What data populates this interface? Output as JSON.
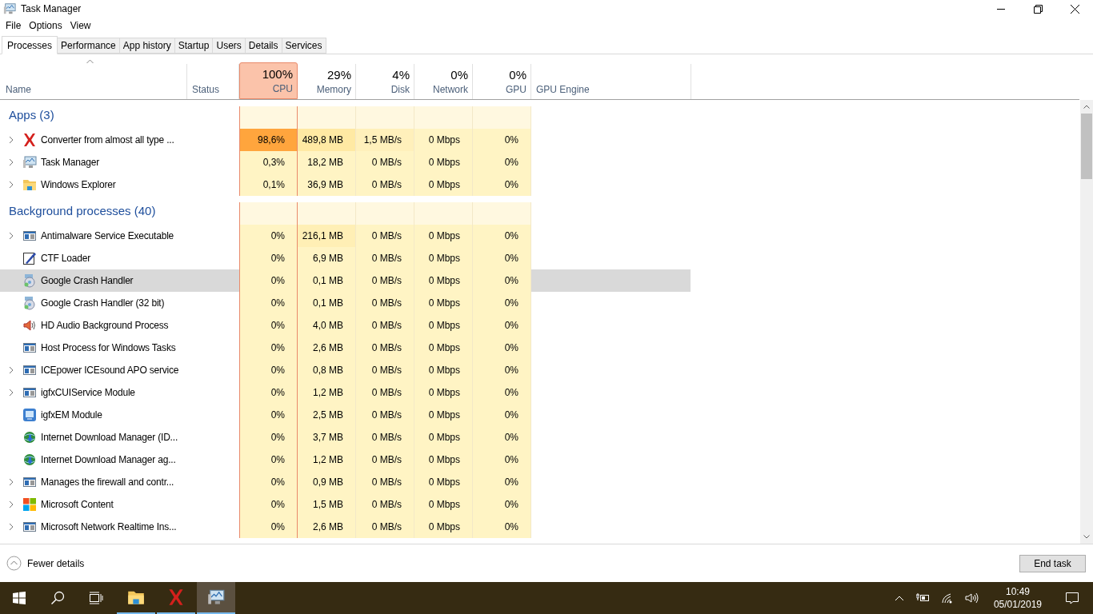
{
  "window": {
    "title": "Task Manager"
  },
  "menu": [
    "File",
    "Options",
    "View"
  ],
  "tabs": [
    {
      "label": "Processes",
      "selected": true
    },
    {
      "label": "Performance",
      "selected": false
    },
    {
      "label": "App history",
      "selected": false
    },
    {
      "label": "Startup",
      "selected": false
    },
    {
      "label": "Users",
      "selected": false
    },
    {
      "label": "Details",
      "selected": false
    },
    {
      "label": "Services",
      "selected": false
    }
  ],
  "columns": [
    {
      "kind": "name",
      "label": "Name"
    },
    {
      "kind": "status",
      "label": "Status"
    },
    {
      "kind": "metric",
      "percent": "100%",
      "label": "CPU",
      "color": "#fbc3aa"
    },
    {
      "kind": "metric",
      "percent": "29%",
      "label": "Memory",
      "color": "#ffffff"
    },
    {
      "kind": "metric",
      "percent": "4%",
      "label": "Disk",
      "color": "#ffffff"
    },
    {
      "kind": "metric",
      "percent": "0%",
      "label": "Network",
      "color": "#ffffff"
    },
    {
      "kind": "metric",
      "percent": "0%",
      "label": "GPU",
      "color": "#ffffff"
    },
    {
      "kind": "engine",
      "label": "GPU Engine"
    }
  ],
  "groups": [
    {
      "title": "Apps (3)",
      "rows": [
        {
          "name": "Converter from almost all type ...",
          "kind": "cross",
          "expandable": true,
          "selected": false,
          "cells": [
            {
              "text": "98,6%",
              "color": "#ffa53d"
            },
            {
              "text": "489,8 MB",
              "color": "#ffe9a3"
            },
            {
              "text": "1,5 MB/s",
              "color": "#fff0bb"
            },
            {
              "text": "0 Mbps",
              "color": "#fff4c4"
            },
            {
              "text": "0%",
              "color": "#fff4c4"
            }
          ]
        },
        {
          "name": "Task Manager",
          "kind": "monitor",
          "expandable": true,
          "selected": false,
          "cells": [
            {
              "text": "0,3%",
              "color": "#fff4c4"
            },
            {
              "text": "18,2 MB",
              "color": "#fff4c4"
            },
            {
              "text": "0 MB/s",
              "color": "#fff4c4"
            },
            {
              "text": "0 Mbps",
              "color": "#fff4c4"
            },
            {
              "text": "0%",
              "color": "#fff4c4"
            }
          ]
        },
        {
          "name": "Windows Explorer",
          "kind": "folder",
          "expandable": true,
          "selected": false,
          "cells": [
            {
              "text": "0,1%",
              "color": "#fff4c4"
            },
            {
              "text": "36,9 MB",
              "color": "#fff4c4"
            },
            {
              "text": "0 MB/s",
              "color": "#fff4c4"
            },
            {
              "text": "0 Mbps",
              "color": "#fff4c4"
            },
            {
              "text": "0%",
              "color": "#fff4c4"
            }
          ]
        }
      ]
    },
    {
      "title": "Background processes (40)",
      "rows": [
        {
          "name": "Antimalware Service Executable",
          "kind": "service",
          "expandable": true,
          "selected": false,
          "cells": [
            {
              "text": "0%",
              "color": "#fff4c4"
            },
            {
              "text": "216,1 MB",
              "color": "#ffefb5"
            },
            {
              "text": "0 MB/s",
              "color": "#fff4c4"
            },
            {
              "text": "0 Mbps",
              "color": "#fff4c4"
            },
            {
              "text": "0%",
              "color": "#fff4c4"
            }
          ]
        },
        {
          "name": "CTF Loader",
          "kind": "pen",
          "expandable": false,
          "selected": false,
          "cells": [
            {
              "text": "0%",
              "color": "#fff4c4"
            },
            {
              "text": "6,9 MB",
              "color": "#fff4c4"
            },
            {
              "text": "0 MB/s",
              "color": "#fff4c4"
            },
            {
              "text": "0 Mbps",
              "color": "#fff4c4"
            },
            {
              "text": "0%",
              "color": "#fff4c4"
            }
          ]
        },
        {
          "name": "Google Crash Handler",
          "kind": "disc",
          "expandable": false,
          "selected": true,
          "cells": [
            {
              "text": "0%",
              "color": "#fff4c4"
            },
            {
              "text": "0,1 MB",
              "color": "#fff4c4"
            },
            {
              "text": "0 MB/s",
              "color": "#fff4c4"
            },
            {
              "text": "0 Mbps",
              "color": "#fff4c4"
            },
            {
              "text": "0%",
              "color": "#fff4c4"
            }
          ]
        },
        {
          "name": "Google Crash Handler (32 bit)",
          "kind": "disc",
          "expandable": false,
          "selected": false,
          "cells": [
            {
              "text": "0%",
              "color": "#fff4c4"
            },
            {
              "text": "0,1 MB",
              "color": "#fff4c4"
            },
            {
              "text": "0 MB/s",
              "color": "#fff4c4"
            },
            {
              "text": "0 Mbps",
              "color": "#fff4c4"
            },
            {
              "text": "0%",
              "color": "#fff4c4"
            }
          ]
        },
        {
          "name": "HD Audio Background Process",
          "kind": "speaker",
          "expandable": false,
          "selected": false,
          "cells": [
            {
              "text": "0%",
              "color": "#fff4c4"
            },
            {
              "text": "4,0 MB",
              "color": "#fff4c4"
            },
            {
              "text": "0 MB/s",
              "color": "#fff4c4"
            },
            {
              "text": "0 Mbps",
              "color": "#fff4c4"
            },
            {
              "text": "0%",
              "color": "#fff4c4"
            }
          ]
        },
        {
          "name": "Host Process for Windows Tasks",
          "kind": "service",
          "expandable": false,
          "selected": false,
          "cells": [
            {
              "text": "0%",
              "color": "#fff4c4"
            },
            {
              "text": "2,6 MB",
              "color": "#fff4c4"
            },
            {
              "text": "0 MB/s",
              "color": "#fff4c4"
            },
            {
              "text": "0 Mbps",
              "color": "#fff4c4"
            },
            {
              "text": "0%",
              "color": "#fff4c4"
            }
          ]
        },
        {
          "name": "ICEpower ICEsound APO service",
          "kind": "service",
          "expandable": true,
          "selected": false,
          "cells": [
            {
              "text": "0%",
              "color": "#fff4c4"
            },
            {
              "text": "0,8 MB",
              "color": "#fff4c4"
            },
            {
              "text": "0 MB/s",
              "color": "#fff4c4"
            },
            {
              "text": "0 Mbps",
              "color": "#fff4c4"
            },
            {
              "text": "0%",
              "color": "#fff4c4"
            }
          ]
        },
        {
          "name": "igfxCUIService Module",
          "kind": "service",
          "expandable": true,
          "selected": false,
          "cells": [
            {
              "text": "0%",
              "color": "#fff4c4"
            },
            {
              "text": "1,2 MB",
              "color": "#fff4c4"
            },
            {
              "text": "0 MB/s",
              "color": "#fff4c4"
            },
            {
              "text": "0 Mbps",
              "color": "#fff4c4"
            },
            {
              "text": "0%",
              "color": "#fff4c4"
            }
          ]
        },
        {
          "name": "igfxEM Module",
          "kind": "screen",
          "expandable": false,
          "selected": false,
          "cells": [
            {
              "text": "0%",
              "color": "#fff4c4"
            },
            {
              "text": "2,5 MB",
              "color": "#fff4c4"
            },
            {
              "text": "0 MB/s",
              "color": "#fff4c4"
            },
            {
              "text": "0 Mbps",
              "color": "#fff4c4"
            },
            {
              "text": "0%",
              "color": "#fff4c4"
            }
          ]
        },
        {
          "name": "Internet Download Manager (ID...",
          "kind": "globe",
          "expandable": false,
          "selected": false,
          "cells": [
            {
              "text": "0%",
              "color": "#fff4c4"
            },
            {
              "text": "3,7 MB",
              "color": "#fff4c4"
            },
            {
              "text": "0 MB/s",
              "color": "#fff4c4"
            },
            {
              "text": "0 Mbps",
              "color": "#fff4c4"
            },
            {
              "text": "0%",
              "color": "#fff4c4"
            }
          ]
        },
        {
          "name": "Internet Download Manager ag...",
          "kind": "globe",
          "expandable": false,
          "selected": false,
          "cells": [
            {
              "text": "0%",
              "color": "#fff4c4"
            },
            {
              "text": "1,2 MB",
              "color": "#fff4c4"
            },
            {
              "text": "0 MB/s",
              "color": "#fff4c4"
            },
            {
              "text": "0 Mbps",
              "color": "#fff4c4"
            },
            {
              "text": "0%",
              "color": "#fff4c4"
            }
          ]
        },
        {
          "name": "Manages the firewall and contr...",
          "kind": "service",
          "expandable": true,
          "selected": false,
          "cells": [
            {
              "text": "0%",
              "color": "#fff4c4"
            },
            {
              "text": "0,9 MB",
              "color": "#fff4c4"
            },
            {
              "text": "0 MB/s",
              "color": "#fff4c4"
            },
            {
              "text": "0 Mbps",
              "color": "#fff4c4"
            },
            {
              "text": "0%",
              "color": "#fff4c4"
            }
          ]
        },
        {
          "name": "Microsoft Content",
          "kind": "tiles",
          "expandable": true,
          "selected": false,
          "cells": [
            {
              "text": "0%",
              "color": "#fff4c4"
            },
            {
              "text": "1,5 MB",
              "color": "#fff4c4"
            },
            {
              "text": "0 MB/s",
              "color": "#fff4c4"
            },
            {
              "text": "0 Mbps",
              "color": "#fff4c4"
            },
            {
              "text": "0%",
              "color": "#fff4c4"
            }
          ]
        },
        {
          "name": "Microsoft Network Realtime Ins...",
          "kind": "service",
          "expandable": true,
          "selected": false,
          "cells": [
            {
              "text": "0%",
              "color": "#fff4c4"
            },
            {
              "text": "2,6 MB",
              "color": "#fff4c4"
            },
            {
              "text": "0 MB/s",
              "color": "#fff4c4"
            },
            {
              "text": "0 Mbps",
              "color": "#fff4c4"
            },
            {
              "text": "0%",
              "color": "#fff4c4"
            }
          ]
        }
      ]
    }
  ],
  "footer": {
    "details_link": "Fewer details",
    "button": "End task"
  },
  "taskbar": {
    "apps": [
      {
        "kind": "folder",
        "running": true,
        "selected": false
      },
      {
        "kind": "cross",
        "running": true,
        "selected": false
      },
      {
        "kind": "monitor",
        "running": true,
        "selected": true
      }
    ],
    "time": "10:49",
    "date": "05/01/2019"
  }
}
